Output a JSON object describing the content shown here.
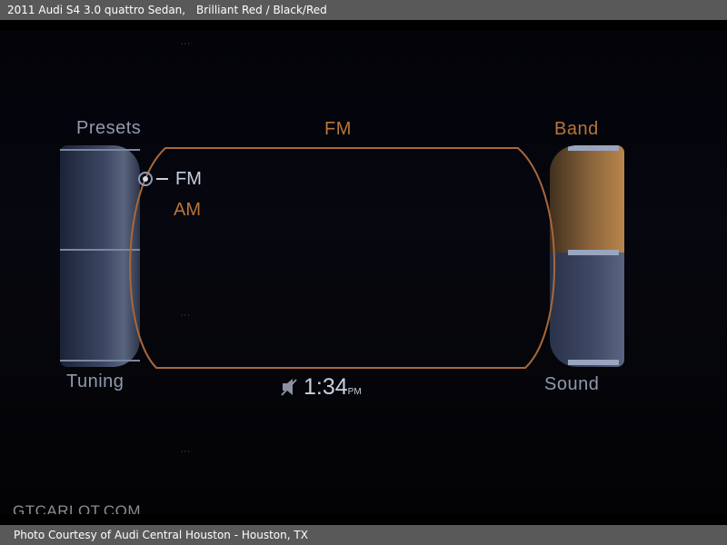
{
  "header": {
    "vehicle": "2011 Audi S4 3.0 quattro Sedan,",
    "color": "Brilliant Red / Black/Red"
  },
  "screen": {
    "title": "FM",
    "presets_label": "Presets",
    "band_label": "Band",
    "tuning_label": "Tuning",
    "sound_label": "Sound",
    "band_options": [
      {
        "label": "FM",
        "selected": true
      },
      {
        "label": "AM",
        "selected": false
      }
    ],
    "clock": {
      "time": "1:34",
      "ampm": "PM"
    },
    "status_icon": "speaker-mute-icon",
    "accent_color": "#b8743a",
    "text_color": "#c6cfdf"
  },
  "watermark": "GTCARLOT.COM",
  "footer": {
    "credit": "Photo Courtesy of Audi Central Houston - Houston, TX"
  }
}
